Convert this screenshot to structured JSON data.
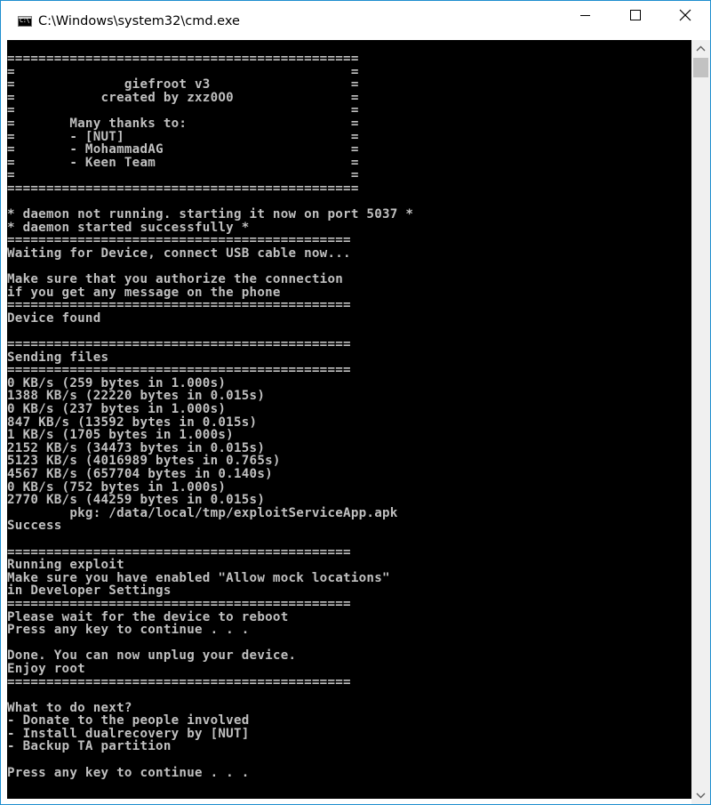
{
  "window": {
    "title": "C:\\Windows\\system32\\cmd.exe",
    "icon": "cmd-icon",
    "icon_text": "C:\\"
  },
  "controls": {
    "minimize": "minimize-icon",
    "maximize": "maximize-icon",
    "close": "close-icon"
  },
  "console": {
    "fg_color": "#c0c0c0",
    "bg_color": "#000000",
    "lines": [
      "=============================================",
      "=                                           =",
      "=              giefroot v3                  =",
      "=           created by zxz0O0               =",
      "=                                           =",
      "=       Many thanks to:                     =",
      "=       - [NUT]                             =",
      "=       - MohammadAG                        =",
      "=       - Keen Team                         =",
      "=                                           =",
      "=============================================",
      "",
      "* daemon not running. starting it now on port 5037 *",
      "* daemon started successfully *",
      "============================================",
      "Waiting for Device, connect USB cable now...",
      "",
      "Make sure that you authorize the connection",
      "if you get any message on the phone",
      "============================================",
      "Device found",
      "",
      "============================================",
      "Sending files",
      "============================================",
      "0 KB/s (259 bytes in 1.000s)",
      "1388 KB/s (22220 bytes in 0.015s)",
      "0 KB/s (237 bytes in 1.000s)",
      "847 KB/s (13592 bytes in 0.015s)",
      "1 KB/s (1705 bytes in 1.000s)",
      "2152 KB/s (34473 bytes in 0.015s)",
      "5123 KB/s (4016989 bytes in 0.765s)",
      "4567 KB/s (657704 bytes in 0.140s)",
      "0 KB/s (752 bytes in 1.000s)",
      "2770 KB/s (44259 bytes in 0.015s)",
      "        pkg: /data/local/tmp/exploitServiceApp.apk",
      "Success",
      "",
      "============================================",
      "Running exploit",
      "Make sure you have enabled \"Allow mock locations\"",
      "in Developer Settings",
      "============================================",
      "Please wait for the device to reboot",
      "Press any key to continue . . .",
      "",
      "Done. You can now unplug your device.",
      "Enjoy root",
      "============================================",
      "",
      "What to do next?",
      "- Donate to the people involved",
      "- Install dualrecovery by [NUT]",
      "- Backup TA partition",
      "",
      "Press any key to continue . . ."
    ]
  }
}
